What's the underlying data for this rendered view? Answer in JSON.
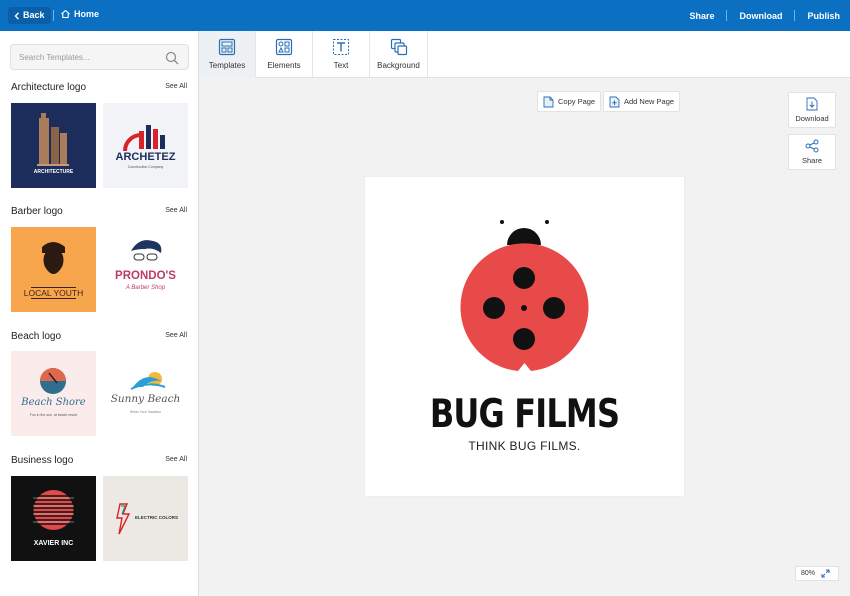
{
  "header": {
    "back_label": "Back",
    "home_label": "Home",
    "share_label": "Share",
    "download_label": "Download",
    "publish_label": "Publish"
  },
  "sidebar": {
    "search_placeholder": "Search Templates...",
    "see_all_label": "See All",
    "categories": [
      {
        "title": "Architecture logo",
        "thumbs": [
          {
            "text": "ARCHITECTURE",
            "sub": "",
            "bg": "#1c2c5b"
          },
          {
            "text": "ARCHETEZ",
            "sub": "Construction Company",
            "bg": "#f2f3f6"
          }
        ]
      },
      {
        "title": "Barber logo",
        "thumbs": [
          {
            "text": "LOCAL YOUTH",
            "sub": "",
            "bg": "#f7a64d"
          },
          {
            "text": "PRONDO'S",
            "sub": "A Barber Shop",
            "bg": "#ffffff"
          }
        ]
      },
      {
        "title": "Beach logo",
        "thumbs": [
          {
            "text": "Beach Shore",
            "sub": "Fun in the sun, at beach resort",
            "bg": "#fbecec"
          },
          {
            "text": "Sunny Beach",
            "sub": "Relax Your Vacation",
            "bg": "#ffffff"
          }
        ]
      },
      {
        "title": "Business logo",
        "thumbs": [
          {
            "text": "XAVIER INC",
            "sub": "",
            "bg": "#111111"
          },
          {
            "text": "ELECTRIC COLORS",
            "sub": "",
            "bg": "#ece9e4"
          }
        ]
      }
    ]
  },
  "toolbar": {
    "tools": [
      {
        "label": "Templates",
        "icon": "templates-icon"
      },
      {
        "label": "Elements",
        "icon": "elements-icon"
      },
      {
        "label": "Text",
        "icon": "text-icon"
      },
      {
        "label": "Background",
        "icon": "background-icon"
      }
    ]
  },
  "canvas": {
    "copy_page_label": "Copy Page",
    "add_page_label": "Add New Page",
    "download_label": "Download",
    "share_label": "Share",
    "logo_name": "BUG FILMS",
    "logo_tagline": "THINK BUG FILMS.",
    "zoom_label": "80%"
  },
  "colors": {
    "brand_blue": "#0b6fc2",
    "ladybug_red": "#e84a4a"
  }
}
